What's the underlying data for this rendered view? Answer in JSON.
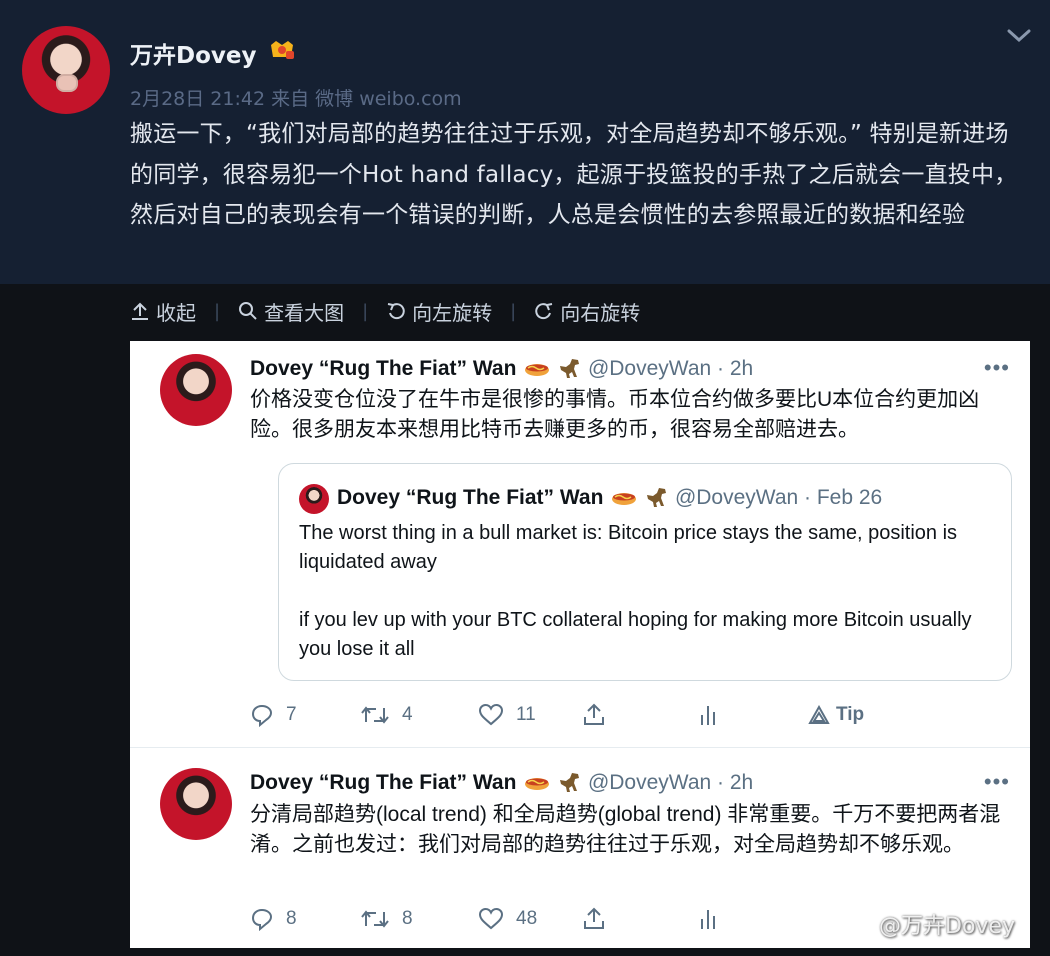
{
  "post": {
    "author": "万卉Dovey",
    "timestamp": "2月28日 21:42",
    "source": "来自 微博 weibo.com",
    "text": "搬运一下，“我们对局部的趋势往往过于乐观，对全局趋势却不够乐观。” 特别是新进场的同学，很容易犯一个Hot hand fallacy，起源于投篮投的手热了之后就会一直投中，然后对自己的表现会有一个错误的判断，人总是会惯性的去参照最近的数据和经验"
  },
  "toolbar": {
    "collapse": "收起",
    "view_large": "查看大图",
    "rotate_left": "向左旋转",
    "rotate_right": "向右旋转"
  },
  "tweets": [
    {
      "display_name": "Dovey “Rug The Fiat” Wan",
      "handle_time": "@DoveyWan · 2h",
      "more": "•••",
      "text": "价格没变仓位没了在牛市是很惨的事情。币本位合约做多要比U本位合约更加凶险。很多朋友本来想用比特币去赚更多的币，很容易全部赔进去。",
      "quote": {
        "display_name": "Dovey “Rug The Fiat” Wan",
        "handle_time": "@DoveyWan · Feb 26",
        "line1": "The worst thing in a bull market is: Bitcoin price stays the same, position is liquidated away",
        "line2": "if you lev up with your BTC collateral hoping for making more Bitcoin usually you lose it all"
      },
      "replies": "7",
      "retweets": "4",
      "likes": "11",
      "tip": "Tip"
    },
    {
      "display_name": "Dovey “Rug The Fiat” Wan",
      "handle_time": "@DoveyWan · 2h",
      "more": "•••",
      "text": "分清局部趋势(local trend) 和全局趋势(global trend) 非常重要。千万不要把两者混淆。之前也发过：我们对局部的趋势往往过于乐观，对全局趋势却不够乐观。",
      "replies": "8",
      "retweets": "8",
      "likes": "48"
    }
  ],
  "watermark": "@万卉Dovey",
  "colors": {
    "page_bg": "#0f1217",
    "post_bg": "#152032",
    "meta_text": "#5a6a86",
    "tweet_secondary": "#5b7083"
  }
}
